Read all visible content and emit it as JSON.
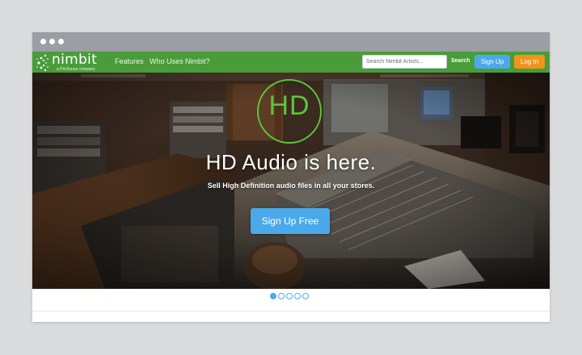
{
  "brand": {
    "name": "nimbit",
    "tagline": "a PreSonus company",
    "color": "#4a9c3b"
  },
  "nav": {
    "links": [
      "Features",
      "Who Uses Nimbit?"
    ]
  },
  "search": {
    "placeholder": "Search Nimbit Artists...",
    "button_label": "Search"
  },
  "auth": {
    "signup_label": "Sign Up",
    "login_label": "Log In",
    "signup_color": "#4aa9ea",
    "login_color": "#f0941c"
  },
  "hero": {
    "badge": "HD",
    "title": "HD Audio is here.",
    "subtitle": "Sell High Definition audio files in all your stores.",
    "cta_label": "Sign Up Free",
    "accent_color": "#5ec33c"
  },
  "carousel": {
    "count": 5,
    "active_index": 0
  },
  "icons": {
    "window_controls": [
      "dot-icon",
      "dot-icon",
      "dot-icon"
    ],
    "logo": "nimbit-logo-icon"
  }
}
